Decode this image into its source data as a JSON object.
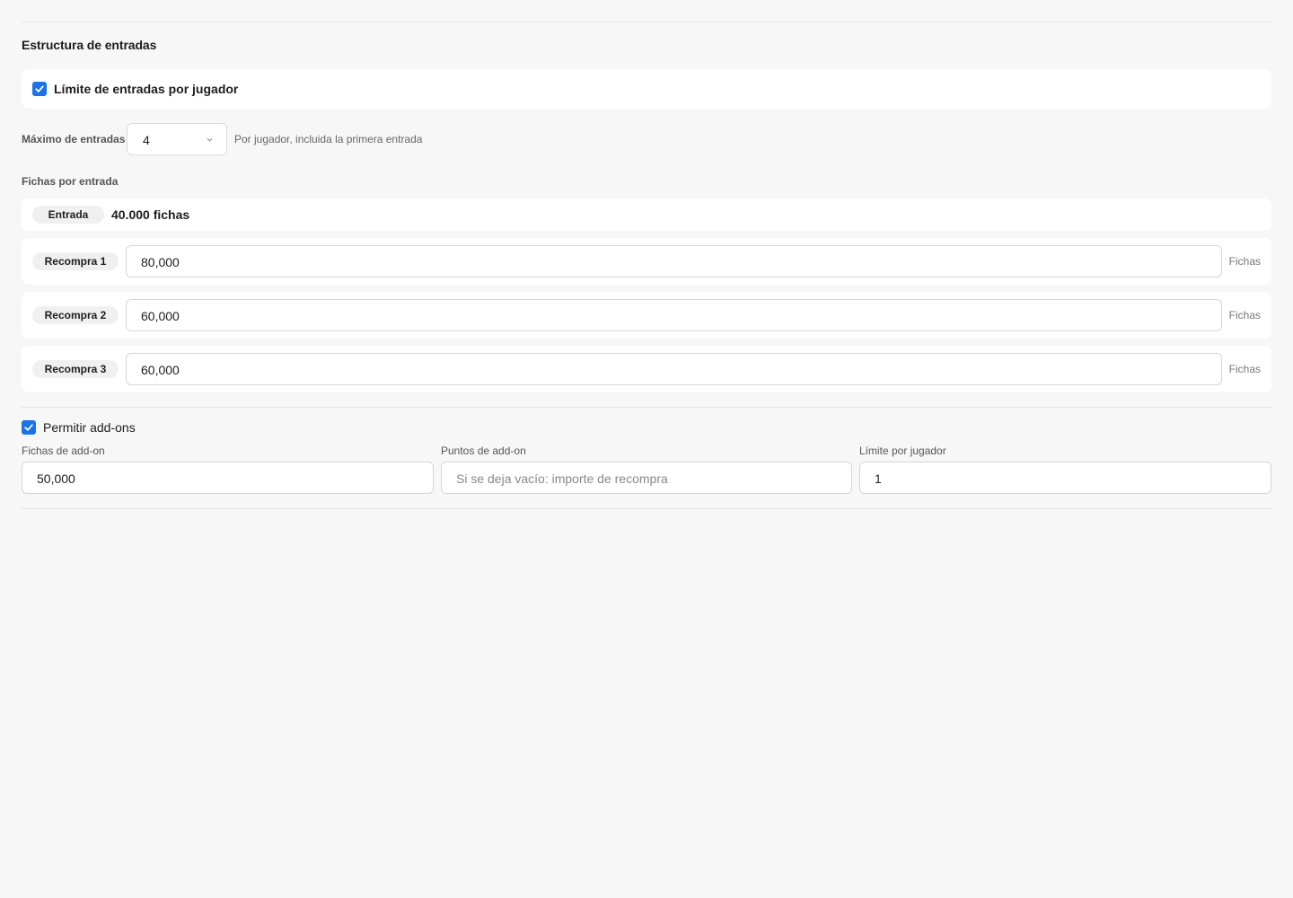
{
  "section": {
    "title": "Estructura de entradas"
  },
  "entry_limit": {
    "checked": true,
    "label": "Límite de entradas por jugador"
  },
  "max_entries": {
    "label": "Máximo de entradas",
    "value": "4",
    "hint": "Por jugador, incluida la primera entrada"
  },
  "chips": {
    "label": "Fichas por entrada",
    "entry": {
      "label": "Entrada",
      "value": "40.000 fichas"
    },
    "rebuys": [
      {
        "label": "Recompra 1",
        "value": "80,000",
        "unit": "Fichas"
      },
      {
        "label": "Recompra 2",
        "value": "60,000",
        "unit": "Fichas"
      },
      {
        "label": "Recompra 3",
        "value": "60,000",
        "unit": "Fichas"
      }
    ]
  },
  "addons": {
    "checked": true,
    "label": "Permitir add-ons",
    "fields": [
      {
        "label": "Fichas de add-on",
        "value": "50,000",
        "placeholder": ""
      },
      {
        "label": "Puntos de add-on",
        "value": "",
        "placeholder": "Si se deja vacío: importe de recompra"
      },
      {
        "label": "Límite por jugador",
        "value": "1",
        "placeholder": ""
      }
    ]
  },
  "colors": {
    "accent": "#1a73e8",
    "background": "#f7f7f7",
    "card": "#ffffff"
  }
}
